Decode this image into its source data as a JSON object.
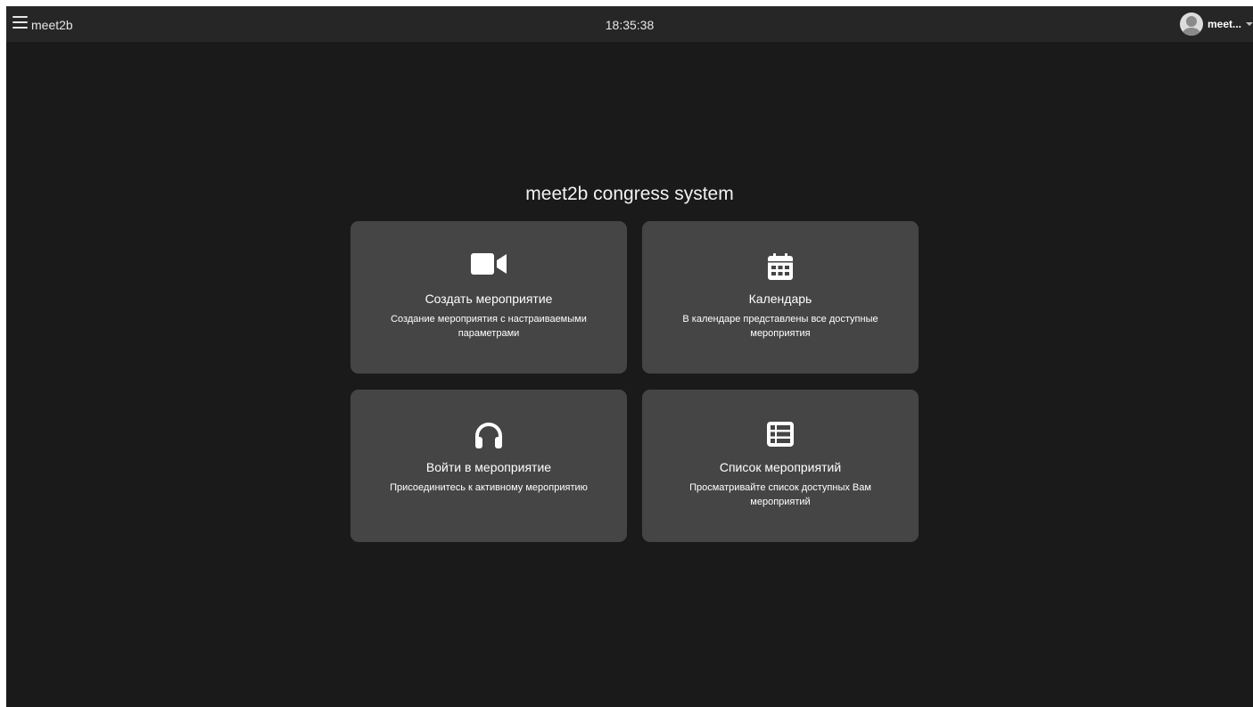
{
  "header": {
    "brand": "meet2b",
    "time": "18:35:38",
    "user_name": "meet..."
  },
  "main": {
    "title": "meet2b congress system",
    "cards": [
      {
        "icon": "video-camera-icon",
        "title": "Создать мероприятие",
        "description": "Создание мероприятия с настраиваемыми параметрами"
      },
      {
        "icon": "calendar-icon",
        "title": "Календарь",
        "description": "В календаре представлены все доступные мероприятия"
      },
      {
        "icon": "headphones-icon",
        "title": "Войти в мероприятие",
        "description": "Присоединитесь к активному мероприятию"
      },
      {
        "icon": "list-icon",
        "title": "Список мероприятий",
        "description": "Просматривайте список доступных Вам мероприятий"
      }
    ]
  },
  "colors": {
    "background": "#1a1a1a",
    "topbar": "#262626",
    "card": "#454545",
    "text": "#ffffff"
  }
}
